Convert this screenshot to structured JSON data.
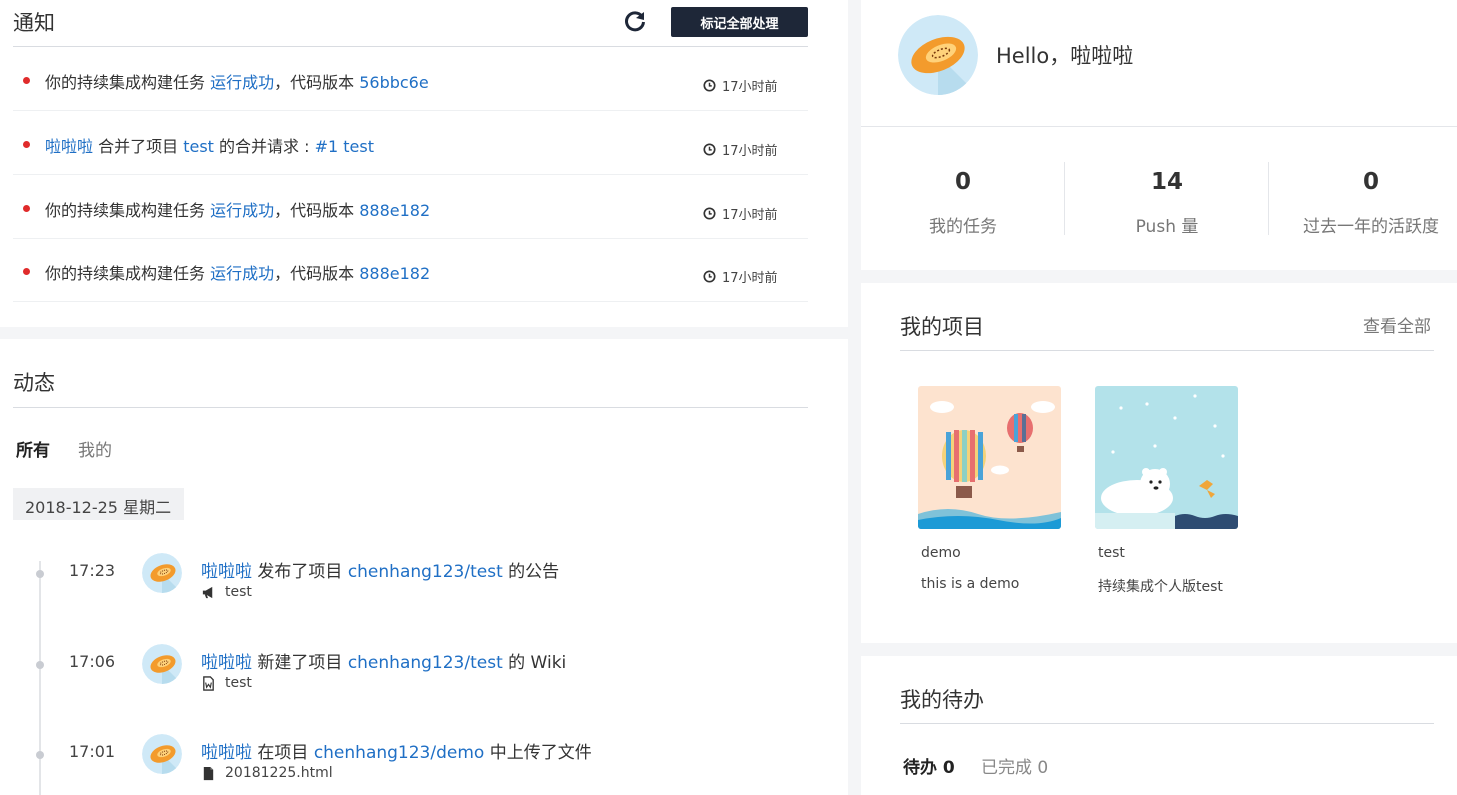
{
  "notices": {
    "title": "通知",
    "mark_all_label": "标记全部处理",
    "items": [
      {
        "prefix": "你的持续集成构建任务 ",
        "link1": "运行成功",
        "mid": "，代码版本 ",
        "link2": "56bbc6e",
        "time": "17小时前"
      },
      {
        "link0": "啦啦啦",
        "prefix": " 合并了项目 ",
        "link1": "test",
        "mid": " 的合并请求 : ",
        "link2": "#1 test",
        "time": "17小时前"
      },
      {
        "prefix": "你的持续集成构建任务 ",
        "link1": "运行成功",
        "mid": "，代码版本 ",
        "link2": "888e182",
        "time": "17小时前"
      },
      {
        "prefix": "你的持续集成构建任务 ",
        "link1": "运行成功",
        "mid": "，代码版本 ",
        "link2": "888e182",
        "time": "17小时前"
      }
    ]
  },
  "feed": {
    "title": "动态",
    "tabs": [
      "所有",
      "我的"
    ],
    "date": "2018-12-25 星期二",
    "items": [
      {
        "time": "17:23",
        "user": "啦啦啦",
        "action": " 发布了项目 ",
        "project": "chenhang123/test",
        "suffix": " 的公告",
        "sub_icon": "megaphone-icon",
        "sub": "test"
      },
      {
        "time": "17:06",
        "user": "啦啦啦",
        "action": " 新建了项目 ",
        "project": "chenhang123/test",
        "suffix": " 的 Wiki",
        "sub_icon": "wiki-file-icon",
        "sub": "test"
      },
      {
        "time": "17:01",
        "user": "啦啦啦",
        "action": " 在项目 ",
        "project": "chenhang123/demo",
        "suffix": " 中上传了文件",
        "sub_icon": "file-icon",
        "sub": "20181225.html"
      }
    ]
  },
  "profile": {
    "greeting": "Hello，啦啦啦"
  },
  "stats": [
    {
      "value": "0",
      "label": "我的任务"
    },
    {
      "value": "14",
      "label": "Push 量"
    },
    {
      "value": "0",
      "label": "过去一年的活跃度"
    }
  ],
  "projects": {
    "title": "我的项目",
    "view_all": "查看全部",
    "items": [
      {
        "name": "demo",
        "desc": "this is a demo"
      },
      {
        "name": "test",
        "desc": "持续集成个人版test"
      }
    ]
  },
  "todo": {
    "title": "我的待办",
    "tab_pending": "待办 0",
    "tab_done": "已完成 0"
  },
  "colors": {
    "accent": "#1f6fc5",
    "dark_button": "#1e2738",
    "unread_dot": "#e02b2b"
  }
}
